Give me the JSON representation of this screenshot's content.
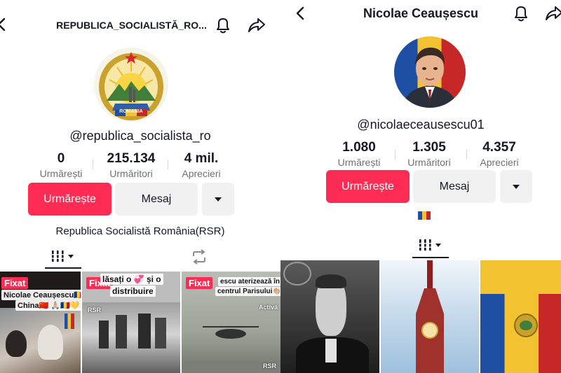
{
  "left": {
    "header": {
      "title": "REPUBLICA_SOCIALISTĂ_RO...",
      "back_icon": "chevron-left-icon",
      "bell_icon": "bell-icon",
      "share_icon": "share-icon"
    },
    "avatar": {
      "type": "emblem",
      "text": "ROMANIA"
    },
    "handle": "@republica_socialista_ro",
    "stats": [
      {
        "value": "0",
        "label": "Urmărești"
      },
      {
        "value": "215.134",
        "label": "Urmăritori"
      },
      {
        "value": "4 mil.",
        "label": "Aprecieri"
      }
    ],
    "buttons": {
      "follow": "Urmărește",
      "message": "Mesaj",
      "more_icon": "caret-down-icon"
    },
    "bio": "Republica Socialistă România(RSR)",
    "tabs": {
      "grid_icon": "grid-icon",
      "repost_icon": "repost-icon"
    },
    "videos": [
      {
        "pinned": "Fixat",
        "caption": "Nicolae Ceaușescu🇷🇴 în",
        "caption2": "China🇨🇳 🙏🏼🇷🇴💛"
      },
      {
        "pinned": "Fixat",
        "caption": "lăsați o 💞 și o",
        "caption2": "distribuire",
        "tag": "RSR"
      },
      {
        "pinned": "Fixat",
        "caption": "escu aterizează în",
        "caption2": "centrul Parisului👏🏼👏🏼",
        "tag": "Activă",
        "tag2": "RSR"
      }
    ]
  },
  "right": {
    "header": {
      "title": "Nicolae Ceaușescu",
      "back_icon": "chevron-left-icon",
      "bell_icon": "bell-icon",
      "share_icon": "share-icon"
    },
    "handle": "@nicolaeceausescu01",
    "stats": [
      {
        "value": "1.080",
        "label": "Urmărești"
      },
      {
        "value": "1.305",
        "label": "Urmăritori"
      },
      {
        "value": "4.357",
        "label": "Aprecieri"
      }
    ],
    "buttons": {
      "follow": "Urmărește",
      "message": "Mesaj",
      "more_icon": "caret-down-icon"
    },
    "bio": "🇷🇴",
    "tabs": {
      "grid_icon": "grid-icon"
    }
  },
  "colors": {
    "accent": "#fe2c55",
    "text": "#161823",
    "muted": "#6f7077",
    "button_gray": "#f1f1f2"
  }
}
